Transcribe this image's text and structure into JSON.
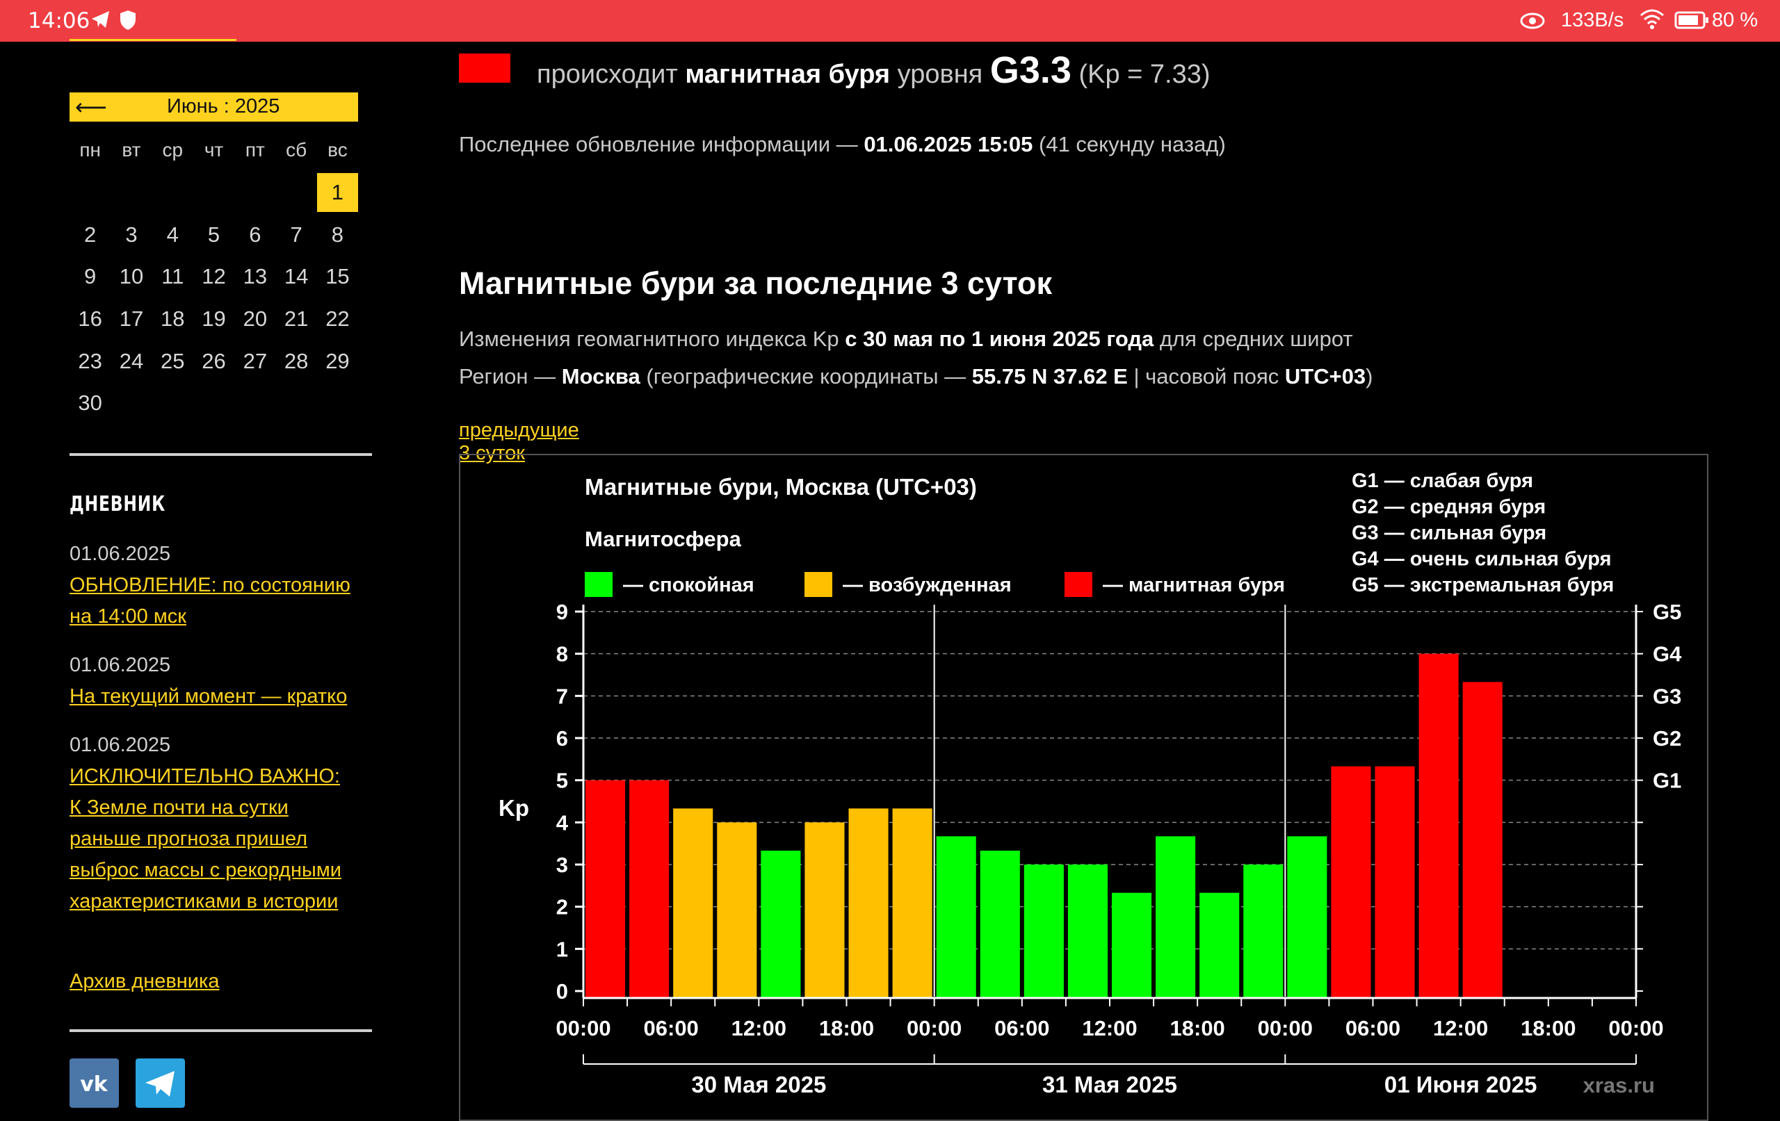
{
  "status_bar": {
    "time": "14:06",
    "network_speed": "133B/s",
    "battery": "80 %",
    "icons": [
      "telegram-icon",
      "shield-icon",
      "eye-icon",
      "wifi-icon",
      "battery-icon"
    ]
  },
  "calendar": {
    "back_arrow": "⟵",
    "title": "Июнь : 2025",
    "weekdays": [
      "пн",
      "вт",
      "ср",
      "чт",
      "пт",
      "сб",
      "вс"
    ],
    "first_weekday_offset": 6,
    "days": [
      "1",
      "2",
      "3",
      "4",
      "5",
      "6",
      "7",
      "8",
      "9",
      "10",
      "11",
      "12",
      "13",
      "14",
      "15",
      "16",
      "17",
      "18",
      "19",
      "20",
      "21",
      "22",
      "23",
      "24",
      "25",
      "26",
      "27",
      "28",
      "29",
      "30"
    ],
    "selected_day": "1"
  },
  "diary": {
    "title": "ДНЕВНИК",
    "entries": [
      {
        "date": "01.06.2025",
        "lines": [
          "ОБНОВЛЕНИЕ: по состоянию",
          "на 14:00 мск"
        ]
      },
      {
        "date": "01.06.2025",
        "lines": [
          "На текущий момент — кратко"
        ]
      },
      {
        "date": "01.06.2025",
        "lines": [
          "ИСКЛЮЧИТЕЛЬНО ВАЖНО:",
          "К Земле почти на сутки",
          "раньше прогноза пришел",
          "выброс массы с рекордными",
          "характеристиками в истории"
        ]
      }
    ],
    "archive_link": "Архив дневника"
  },
  "social": {
    "vk_icon": "vk-icon",
    "vk_color": "#4a76a8",
    "telegram_icon": "telegram-icon",
    "telegram_color": "#2aa3de"
  },
  "status": {
    "prefix": "происходит",
    "bold": "магнитная буря",
    "middle": "уровня",
    "level": "G3.3",
    "kp": "(Kp = 7.33)",
    "color": "#ff0000"
  },
  "update": {
    "prefix": "Последнее обновление информации —",
    "datetime": "01.06.2025 15:05",
    "ago": "(41 секунду назад)"
  },
  "section": {
    "title": "Магнитные бури за последние 3 суток",
    "desc1_prefix": "Изменения геомагнитного индекса Kp",
    "desc1_bold": "с 30 мая по 1 июня 2025 года",
    "desc1_suffix": "для средних широт",
    "desc2_prefix": "Регион —",
    "desc2_region": "Москва",
    "desc2_mid": "(географические координаты —",
    "desc2_coords": "55.75 N 37.62 E",
    "desc2_sep": "| часовой пояс",
    "desc2_tz": "UTC+03",
    "desc2_end": ")",
    "prev_link": "предыдущие 3 суток"
  },
  "chart_data": {
    "type": "bar",
    "title": "Магнитные бури, Москва (UTC+03)",
    "legend_title": "Магнитосфера",
    "legend": [
      {
        "label": "— спокойная",
        "color": "#00ff00"
      },
      {
        "label": "— возбужденная",
        "color": "#ffc000"
      },
      {
        "label": "— магнитная буря",
        "color": "#ff0000"
      }
    ],
    "g_scale_legend": [
      "G1 — слабая буря",
      "G2 — средняя буря",
      "G3 — сильная буря",
      "G4 — очень сильная буря",
      "G5 — экстремальная буря"
    ],
    "ylabel": "Kp",
    "ylim": [
      0,
      9
    ],
    "yticks": [
      "0",
      "1",
      "2",
      "3",
      "4",
      "5",
      "6",
      "7",
      "8",
      "9"
    ],
    "right_axis": [
      {
        "label": "G1",
        "kp": 5
      },
      {
        "label": "G2",
        "kp": 6
      },
      {
        "label": "G3",
        "kp": 7
      },
      {
        "label": "G4",
        "kp": 8
      },
      {
        "label": "G5",
        "kp": 9
      }
    ],
    "xticks": [
      "00:00",
      "06:00",
      "12:00",
      "18:00",
      "00:00",
      "06:00",
      "12:00",
      "18:00",
      "00:00",
      "06:00",
      "12:00",
      "18:00",
      "00:00"
    ],
    "days": [
      "30 Мая 2025",
      "31 Мая 2025",
      "01 Июня 2025"
    ],
    "total_slots": 24,
    "values": [
      5.0,
      5.0,
      4.33,
      4.0,
      3.33,
      4.0,
      4.33,
      4.33,
      3.67,
      3.33,
      3.0,
      3.0,
      2.33,
      3.67,
      2.33,
      3.0,
      3.67,
      5.33,
      5.33,
      8.0,
      7.33
    ],
    "grid": "dashed at each Kp level",
    "watermark": "xras.ru",
    "colors": {
      "quiet": "#00ff00",
      "active": "#ffc000",
      "storm": "#ff0000"
    }
  }
}
